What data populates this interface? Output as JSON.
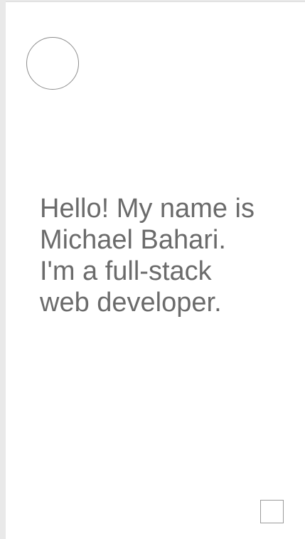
{
  "hero": {
    "avatar_icon": "circle-outline-icon",
    "intro_lines": [
      "Hello! My name is",
      "Michael Bahari.",
      "I'm a full-stack",
      "web developer."
    ]
  },
  "footer": {
    "corner_icon": "square-outline-icon"
  },
  "colors": {
    "background": "#e9e9e9",
    "page": "#ffffff",
    "text": "#6b6b6b",
    "outline": "#8d8d8d"
  }
}
